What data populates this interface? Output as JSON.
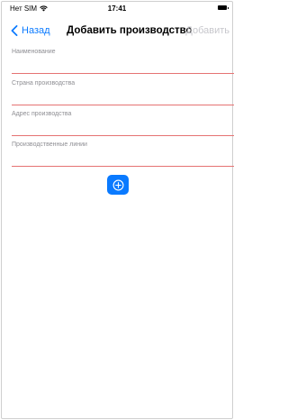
{
  "status_bar": {
    "carrier": "Нет SIM",
    "time": "17:41"
  },
  "nav": {
    "back_label": "Назад",
    "title": "Добавить производство",
    "add_label": "Добавить"
  },
  "form": {
    "fields": [
      {
        "label": "Наименование",
        "value": ""
      },
      {
        "label": "Страна производства",
        "value": ""
      },
      {
        "label": "Адрес производства",
        "value": ""
      },
      {
        "label": "Производственные линии",
        "value": ""
      }
    ]
  },
  "colors": {
    "accent": "#0a7aff",
    "field_underline": "#e57373",
    "disabled_text": "#c7c7cc",
    "label_text": "#8e8e93"
  }
}
